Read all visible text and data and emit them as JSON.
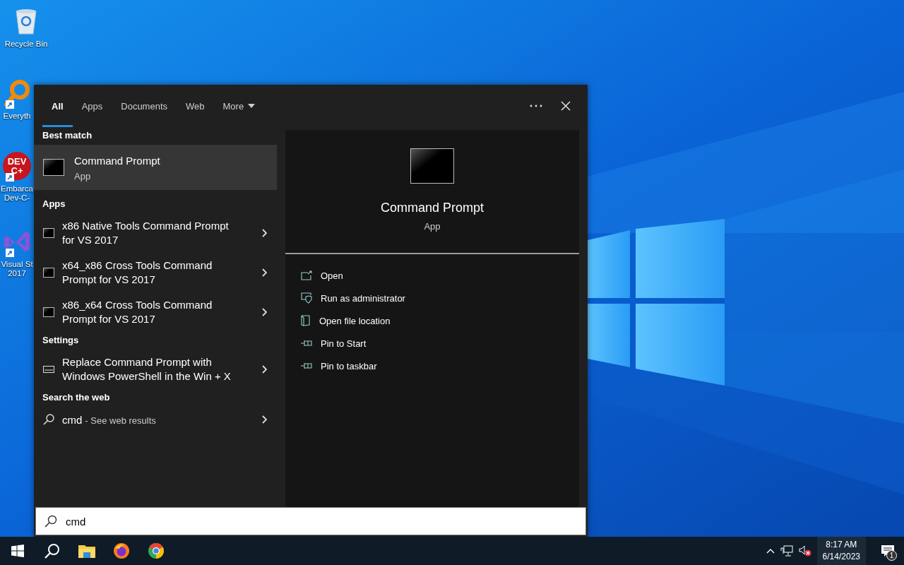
{
  "desktop_icons": [
    {
      "kind": "recycle",
      "lines": [
        "Recycle Bin"
      ]
    },
    {
      "kind": "everything",
      "lines": [
        "Everyth"
      ]
    },
    {
      "kind": "devcpp",
      "logo": "DEV\nC+",
      "lines": [
        "Embarca",
        "Dev-C-"
      ]
    },
    {
      "kind": "vs",
      "lines": [
        "Visual St",
        "2017"
      ]
    }
  ],
  "search_panel": {
    "tabs": [
      {
        "label": "All",
        "selected": true,
        "dropdown": false
      },
      {
        "label": "Apps",
        "selected": false,
        "dropdown": false
      },
      {
        "label": "Documents",
        "selected": false,
        "dropdown": false
      },
      {
        "label": "Web",
        "selected": false,
        "dropdown": false
      },
      {
        "label": "More",
        "selected": false,
        "dropdown": true
      }
    ],
    "sections": [
      {
        "heading": "Best match",
        "items": [
          {
            "kind": "best",
            "title": "Command Prompt",
            "subtitle": "App",
            "selected": true
          }
        ]
      },
      {
        "heading": "Apps",
        "items": [
          {
            "kind": "app",
            "title": "x86 Native Tools Command Prompt for VS 2017",
            "selected": false
          },
          {
            "kind": "app",
            "title": "x64_x86 Cross Tools Command Prompt for VS 2017",
            "selected": false
          },
          {
            "kind": "app",
            "title": "x86_x64 Cross Tools Command Prompt for VS 2017",
            "selected": false
          }
        ]
      },
      {
        "heading": "Settings",
        "items": [
          {
            "kind": "setting",
            "title": "Replace Command Prompt with Windows PowerShell in the Win + X",
            "selected": false
          }
        ]
      },
      {
        "heading": "Search the web",
        "items": [
          {
            "kind": "web",
            "title": "cmd",
            "subtitle": "- See web results",
            "selected": false
          }
        ]
      }
    ],
    "preview": {
      "title": "Command Prompt",
      "subtitle": "App",
      "actions": [
        {
          "kind": "open",
          "label": "Open"
        },
        {
          "kind": "admin",
          "label": "Run as administrator"
        },
        {
          "kind": "folder",
          "label": "Open file location"
        },
        {
          "kind": "pin",
          "label": "Pin to Start"
        },
        {
          "kind": "pin",
          "label": "Pin to taskbar"
        }
      ]
    },
    "search_box": {
      "value": "cmd"
    }
  },
  "taskbar": {
    "apps": [
      {
        "kind": "start"
      },
      {
        "kind": "search"
      },
      {
        "kind": "explorer"
      },
      {
        "kind": "firefox"
      },
      {
        "kind": "chrome"
      }
    ],
    "tray": {
      "icons": [
        {
          "kind": "caret"
        },
        {
          "kind": "network"
        },
        {
          "kind": "volume_muted"
        }
      ],
      "time": "8:17 AM",
      "date": "6/14/2023",
      "notifications": "1"
    }
  }
}
